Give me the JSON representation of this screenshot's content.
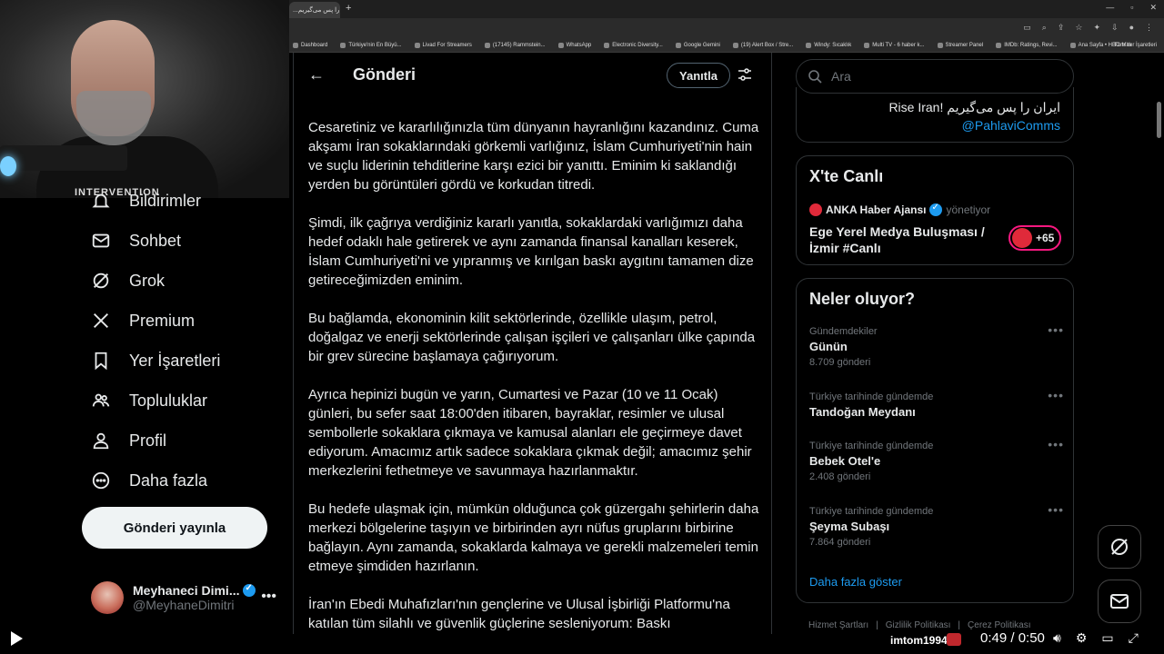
{
  "browser": {
    "tab_title": "...ایران را پس می‌گیریم",
    "bookmarks": [
      "Dashboard",
      "Türkiye'nin En Büyü...",
      "Livad For Streamers",
      "(17145) Rammstein...",
      "WhatsApp",
      "Electronic Diversity...",
      "Google Gemini",
      "(19) Alert Box / Stre...",
      "Windy: Sıcaklık",
      "Multi TV - 6 haber k...",
      "Streamer Panel",
      "IMDb: Ratings, Revi...",
      "Ana Sayfa • HBO Max"
    ],
    "bookmarks_all": "Tüm Yer İşaretleri"
  },
  "webcam": {
    "shirt_text": "INTERVENTION"
  },
  "nav": {
    "items": [
      {
        "label": "Bildirimler",
        "icon": "bell-icon"
      },
      {
        "label": "Sohbet",
        "icon": "mail-icon"
      },
      {
        "label": "Grok",
        "icon": "grok-icon"
      },
      {
        "label": "Premium",
        "icon": "x-logo-icon"
      },
      {
        "label": "Yer İşaretleri",
        "icon": "bookmark-icon"
      },
      {
        "label": "Topluluklar",
        "icon": "communities-icon"
      },
      {
        "label": "Profil",
        "icon": "profile-icon"
      },
      {
        "label": "Daha fazla",
        "icon": "more-circle-icon"
      }
    ],
    "post_button": "Gönderi yayınla"
  },
  "account": {
    "name": "Meyhaneci Dimi...",
    "handle": "@MeyhaneDimitri"
  },
  "main": {
    "title": "Gönderi",
    "reply_button": "Yanıtla",
    "paragraphs": [
      "Cesaretiniz ve kararlılığınızla tüm dünyanın hayranlığını kazandınız. Cuma akşamı İran sokaklarındaki görkemli varlığınız, İslam Cumhuriyeti'nin hain ve suçlu liderinin tehditlerine karşı ezici bir yanıttı. Eminim ki saklandığı yerden bu görüntüleri gördü ve korkudan titredi.",
      "Şimdi, ilk çağrıya verdiğiniz kararlı yanıtla, sokaklardaki varlığımızı daha hedef odaklı hale getirerek ve aynı zamanda finansal kanalları keserek, İslam Cumhuriyeti'ni ve yıpranmış ve kırılgan baskı aygıtını tamamen dize getireceğimizden eminim.",
      "Bu bağlamda, ekonominin kilit sektörlerinde, özellikle ulaşım, petrol, doğalgaz ve enerji sektörlerinde çalışan işçileri ve çalışanları ülke çapında bir grev sürecine başlamaya çağırıyorum.",
      "Ayrıca hepinizi bugün ve yarın, Cumartesi ve Pazar (10 ve 11 Ocak) günleri, bu sefer saat 18:00'den itibaren, bayraklar, resimler ve ulusal sembollerle sokaklara çıkmaya ve kamusal alanları ele geçirmeye davet ediyorum. Amacımız artık sadece sokaklara çıkmak değil; amacımız şehir merkezlerini fethetmeye ve savunmaya hazırlanmaktır.",
      "Bu hedefe ulaşmak için, mümkün olduğunca çok güzergahı şehirlerin daha merkezi bölgelerine taşıyın ve birbirinden ayrı nüfus gruplarını birbirine bağlayın. Aynı zamanda, sokaklarda kalmaya ve gerekli malzemeleri temin etmeye şimdiden hazırlanın.",
      "İran'ın Ebedi Muhafızları'nın gençlerine ve Ulusal İşbirliği Platformu'na katılan tüm silahlı ve güvenlik güçlerine sesleniyorum: Baskı"
    ]
  },
  "search": {
    "placeholder": "Ara"
  },
  "top_card": {
    "text": "ایران را پس می‌گیریم !Rise Iran",
    "mention": "@PahlaviComms"
  },
  "live": {
    "title": "X'te Canlı",
    "source": "ANKA Haber Ajansı",
    "role": "yönetiyor",
    "event": "Ege Yerel Medya Buluşması / İzmir #Canlı",
    "count": "+65"
  },
  "trends": {
    "title": "Neler oluyor?",
    "items": [
      {
        "context": "Gündemdekiler",
        "name": "Günün",
        "count": "8.709 gönderi"
      },
      {
        "context": "Türkiye tarihinde gündemde",
        "name": "Tandoğan Meydanı",
        "count": ""
      },
      {
        "context": "Türkiye tarihinde gündemde",
        "name": "Bebek Otel'e",
        "count": "2.408 gönderi"
      },
      {
        "context": "Türkiye tarihinde gündemde",
        "name": "Şeyma Subaşı",
        "count": "7.864 gönderi"
      }
    ],
    "show_more": "Daha fazla göster"
  },
  "footer": {
    "links": [
      "Hizmet Şartları",
      "Gizlilik Politikası",
      "Çerez Politikası"
    ]
  },
  "video": {
    "channel": "imtom1994",
    "time": "0:49 / 0:50"
  }
}
